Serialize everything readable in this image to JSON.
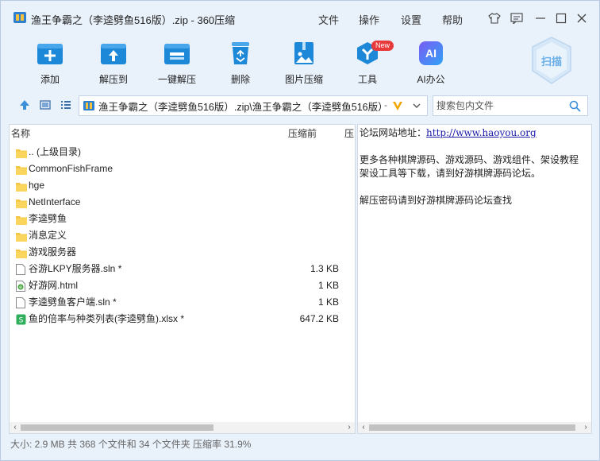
{
  "window": {
    "title": "渔王争霸之（李逵劈鱼516版）.zip - 360压缩",
    "menus": [
      "文件",
      "操作",
      "设置",
      "帮助"
    ]
  },
  "toolbar": {
    "items": [
      {
        "label": "添加",
        "icon": "add-icon"
      },
      {
        "label": "解压到",
        "icon": "extract-to-icon"
      },
      {
        "label": "一键解压",
        "icon": "one-click-extract-icon"
      },
      {
        "label": "删除",
        "icon": "trash-icon"
      },
      {
        "label": "图片压缩",
        "icon": "image-compress-icon"
      },
      {
        "label": "工具",
        "icon": "tools-icon",
        "badge": "New"
      },
      {
        "label": "AI办公",
        "icon": "ai-icon",
        "icon_text": "AI"
      }
    ],
    "scan_label": "扫描"
  },
  "address": {
    "path": "渔王争霸之（李逵劈鱼516版）.zip\\渔王争霸之（李逵劈鱼516版）",
    "search_placeholder": "搜索包内文件"
  },
  "columns": {
    "name": "名称",
    "size_before": "压缩前",
    "size_after": "压"
  },
  "files": [
    {
      "name": ".. (上级目录)",
      "type": "folder",
      "size": ""
    },
    {
      "name": "CommonFishFrame",
      "type": "folder",
      "size": ""
    },
    {
      "name": "hge",
      "type": "folder",
      "size": ""
    },
    {
      "name": "NetInterface",
      "type": "folder",
      "size": ""
    },
    {
      "name": "李逵劈鱼",
      "type": "folder",
      "size": ""
    },
    {
      "name": "消息定义",
      "type": "folder",
      "size": ""
    },
    {
      "name": "游戏服务器",
      "type": "folder",
      "size": ""
    },
    {
      "name": "谷游LKPY服务器.sln *",
      "type": "file",
      "size": "1.3 KB"
    },
    {
      "name": "好游网.html",
      "type": "html",
      "size": "1 KB"
    },
    {
      "name": "李逵劈鱼客户端.sln *",
      "type": "file",
      "size": "1 KB"
    },
    {
      "name": "鱼的倍率与种类列表(李逵劈鱼).xlsx *",
      "type": "xlsx",
      "size": "647.2 KB"
    }
  ],
  "note": {
    "line1_prefix": "论坛网站地址：",
    "line1_link": "http://www.haoyou.org",
    "line2": "更多各种棋牌源码、游戏源码、游戏组件、架设教程",
    "line3": "架设工具等下载，请到好游棋牌源码论坛。",
    "line4": "解压密码请到好游棋牌源码论坛查找"
  },
  "status": "大小: 2.9 MB 共 368 个文件和 34 个文件夹 压缩率 31.9%",
  "colors": {
    "accent": "#1e88d8",
    "bg": "#e9f1fb",
    "folder": "#f5c542",
    "badge": "#e83a3a"
  }
}
